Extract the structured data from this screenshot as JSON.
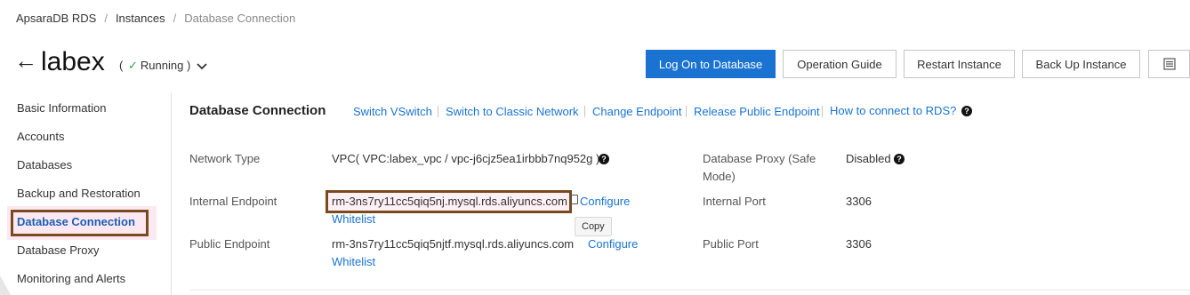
{
  "breadcrumb": {
    "items": [
      "ApsaraDB RDS",
      "Instances",
      "Database Connection"
    ]
  },
  "header": {
    "title": "labex",
    "status_open": "(",
    "status": "Running",
    "status_close": ")",
    "buttons": {
      "logon": "Log On to Database",
      "guide": "Operation Guide",
      "restart": "Restart Instance",
      "backup": "Back Up Instance"
    }
  },
  "sidebar": {
    "items": [
      "Basic Information",
      "Accounts",
      "Databases",
      "Backup and Restoration",
      "Database Connection",
      "Database Proxy",
      "Monitoring and Alerts"
    ],
    "active_index": 4
  },
  "section": {
    "title": "Database Connection",
    "links": {
      "switch_vswitch": "Switch VSwitch",
      "switch_classic": "Switch to Classic Network",
      "change_endpoint": "Change Endpoint",
      "release_public": "Release Public Endpoint",
      "how_to": "How to connect to RDS?"
    }
  },
  "details": {
    "network_type": {
      "label": "Network Type",
      "value": "VPC( VPC:labex_vpc / vpc-j6cjz5ea1irbbb7nq952g )"
    },
    "internal_endpoint": {
      "label": "Internal Endpoint",
      "value": "rm-3ns7ry11cc5qiq5nj.mysql.rds.aliyuncs.com",
      "configure": "Configure",
      "whitelist": "Whitelist"
    },
    "public_endpoint": {
      "label": "Public Endpoint",
      "value": "rm-3ns7ry11cc5qiq5njtf.mysql.rds.aliyuncs.com",
      "configure": "Configure",
      "whitelist": "Whitelist"
    },
    "db_proxy": {
      "label_line1": "Database Proxy (Safe",
      "label_line2": "Mode)",
      "value": "Disabled"
    },
    "internal_port": {
      "label": "Internal Port",
      "value": "3306"
    },
    "public_port": {
      "label": "Public Port",
      "value": "3306"
    }
  },
  "tooltip": {
    "copy": "Copy"
  },
  "colors": {
    "primary": "#1a73d1",
    "running": "#2fa34e",
    "highlight_border": "#7a4a1e",
    "active_bg": "#fbe8f1"
  },
  "icons": [
    "back-arrow-icon",
    "check-icon",
    "chevron-down-icon",
    "help-icon",
    "copy-icon",
    "list-icon"
  ]
}
